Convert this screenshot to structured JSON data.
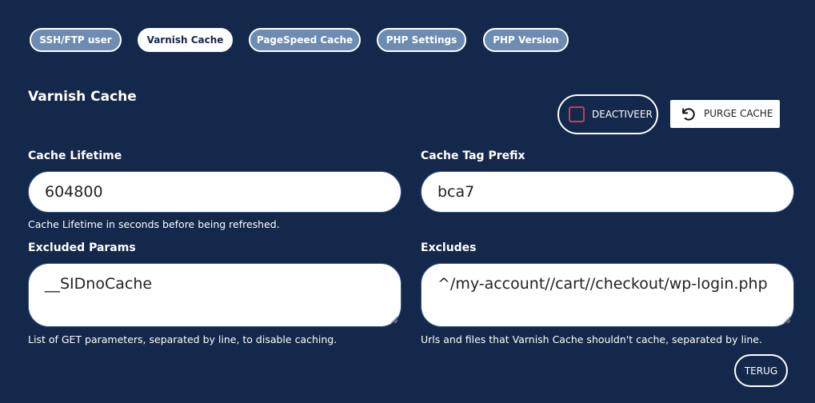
{
  "tabs": [
    {
      "label": "SSH/FTP user",
      "active": false
    },
    {
      "label": "Varnish Cache",
      "active": true
    },
    {
      "label": "PageSpeed Cache",
      "active": false
    },
    {
      "label": "PHP Settings",
      "active": false
    },
    {
      "label": "PHP Version",
      "active": false
    }
  ],
  "section": {
    "title": "Varnish Cache"
  },
  "actions": {
    "deactivate_label": "DEACTIVEER",
    "purge_label": "PURGE CACHE",
    "purge_icon": "undo-arrow-icon",
    "back_label": "TERUG"
  },
  "fields": {
    "cache_lifetime": {
      "label": "Cache Lifetime",
      "value": "604800",
      "help": "Cache Lifetime in seconds before being refreshed."
    },
    "cache_tag_prefix": {
      "label": "Cache Tag Prefix",
      "value": "bca7"
    },
    "excluded_params": {
      "label": "Excluded Params",
      "value": "__SIDnoCache",
      "help": "List of GET parameters, separated by line, to disable caching."
    },
    "excludes": {
      "label": "Excludes",
      "value": "^/my-account//cart//checkout/wp-login.php",
      "help": "Urls and files that Varnish Cache shouldn't cache, separated by line."
    }
  },
  "colors": {
    "background": "#14284b",
    "tab_inactive": "#6d8cb3",
    "checkbox_border": "#c0405a"
  }
}
